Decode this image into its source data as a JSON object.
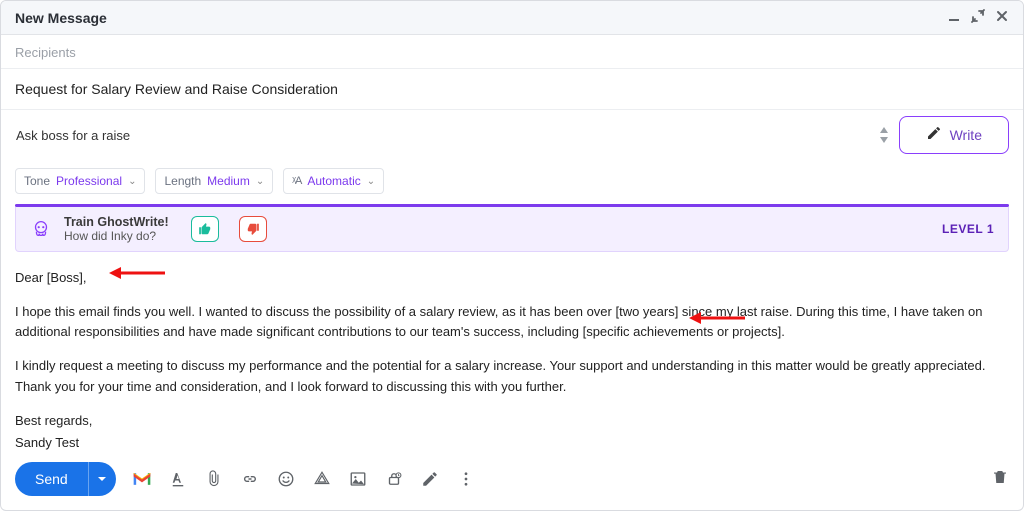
{
  "window": {
    "title": "New Message"
  },
  "recipients": {
    "placeholder": "Recipients"
  },
  "subject": {
    "value": "Request for Salary Review and Raise Consideration"
  },
  "prompt": {
    "value": "Ask boss for a raise"
  },
  "write_button": {
    "label": "Write"
  },
  "filters": {
    "tone": {
      "label": "Tone",
      "value": "Professional"
    },
    "length": {
      "label": "Length",
      "value": "Medium"
    },
    "language": {
      "value": "Automatic"
    }
  },
  "train": {
    "title": "Train GhostWrite!",
    "sub": "How did Inky do?",
    "level": "LEVEL 1"
  },
  "body": {
    "greeting": "Dear [Boss],",
    "p1": "I hope this email finds you well. I wanted to discuss the possibility of a salary review, as it has been over [two years] since my last raise. During this time, I have taken on additional responsibilities and have made significant contributions to our team's success, including [specific achievements or projects].",
    "p2": "I kindly request a meeting to discuss my performance and the potential for a salary increase. Your support and understanding in this matter would be greatly appreciated. Thank you for your time and consideration, and I look forward to discussing this with you further.",
    "closing": "Best regards,",
    "signature": "Sandy Test"
  },
  "send": {
    "label": "Send"
  }
}
